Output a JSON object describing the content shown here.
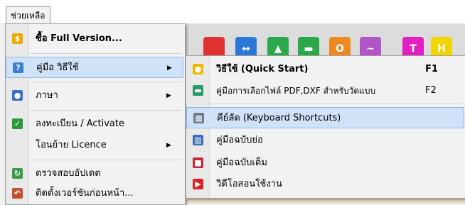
{
  "menubar": {
    "help_label": "ช่วยเหลือ"
  },
  "toolbar": {
    "buttons": [
      {
        "glyph": "",
        "color": "#e03030"
      },
      {
        "glyph": "↔",
        "color": "#2c78d8"
      },
      {
        "glyph": "▲",
        "color": "#2aa84a"
      },
      {
        "glyph": "▬",
        "color": "#2aa84a"
      },
      {
        "glyph": "O",
        "color": "#f08a20"
      },
      {
        "glyph": "~",
        "color": "#b054c8"
      },
      {
        "glyph": "T",
        "color": "#e020c0"
      },
      {
        "glyph": "H",
        "color": "#f2d400"
      }
    ]
  },
  "main_menu": {
    "items": [
      {
        "label": "ซื้อ Full Version...",
        "icon": "dollar-icon",
        "icon_glyph": "$",
        "icon_color": "#e8a800"
      },
      {
        "label": "คู่มือ วิธีใช้",
        "icon": "help-icon",
        "icon_glyph": "?",
        "icon_color": "#3a7fd0"
      },
      {
        "label": "ภาษา",
        "icon": "language-icon",
        "icon_glyph": "●",
        "icon_color": "#3a6fd0"
      },
      {
        "label": "ลงทะเบียน / Activate",
        "icon": "checkmark-icon",
        "icon_glyph": "✓",
        "icon_color": "#2a9a3a"
      },
      {
        "label": "โอนย้าย Licence",
        "icon": "",
        "icon_glyph": "",
        "icon_color": ""
      },
      {
        "label": "ตรวจสอบอัปเดต",
        "icon": "refresh-icon",
        "icon_glyph": "↻",
        "icon_color": "#3a9a4a"
      },
      {
        "label": "ติดตั้งเวอร์ชันก่อนหน้า...",
        "icon": "rollback-icon",
        "icon_glyph": "↶",
        "icon_color": "#c05030"
      }
    ]
  },
  "sub_menu": {
    "items": [
      {
        "label": "วิธีใช้ (Quick Start)",
        "shortcut": "F1",
        "icon": "lightbulb-icon",
        "icon_glyph": "●",
        "icon_color": "#f0b800"
      },
      {
        "label": "คู่มือการเลือกไฟล์ PDF,DXF สำหรับวัดแบบ",
        "shortcut": "F2",
        "icon": "file-guide-icon",
        "icon_glyph": "▬",
        "icon_color": "#2a9a6a"
      },
      {
        "label": "คีย์ลัด (Keyboard Shortcuts)",
        "shortcut": "",
        "icon": "keyboard-icon",
        "icon_glyph": "▦",
        "icon_color": "#6a7a8a"
      },
      {
        "label": "คู่มือฉบับย่อ",
        "shortcut": "",
        "icon": "book-icon",
        "icon_glyph": "▥",
        "icon_color": "#3a6fb8"
      },
      {
        "label": "คู่มือฉบับเต็ม",
        "shortcut": "",
        "icon": "manual-icon",
        "icon_glyph": "■",
        "icon_color": "#c02a3a"
      },
      {
        "label": "วิดีโอสอนใช้งาน",
        "shortcut": "",
        "icon": "video-icon",
        "icon_glyph": "▶",
        "icon_color": "#e02020"
      }
    ]
  }
}
